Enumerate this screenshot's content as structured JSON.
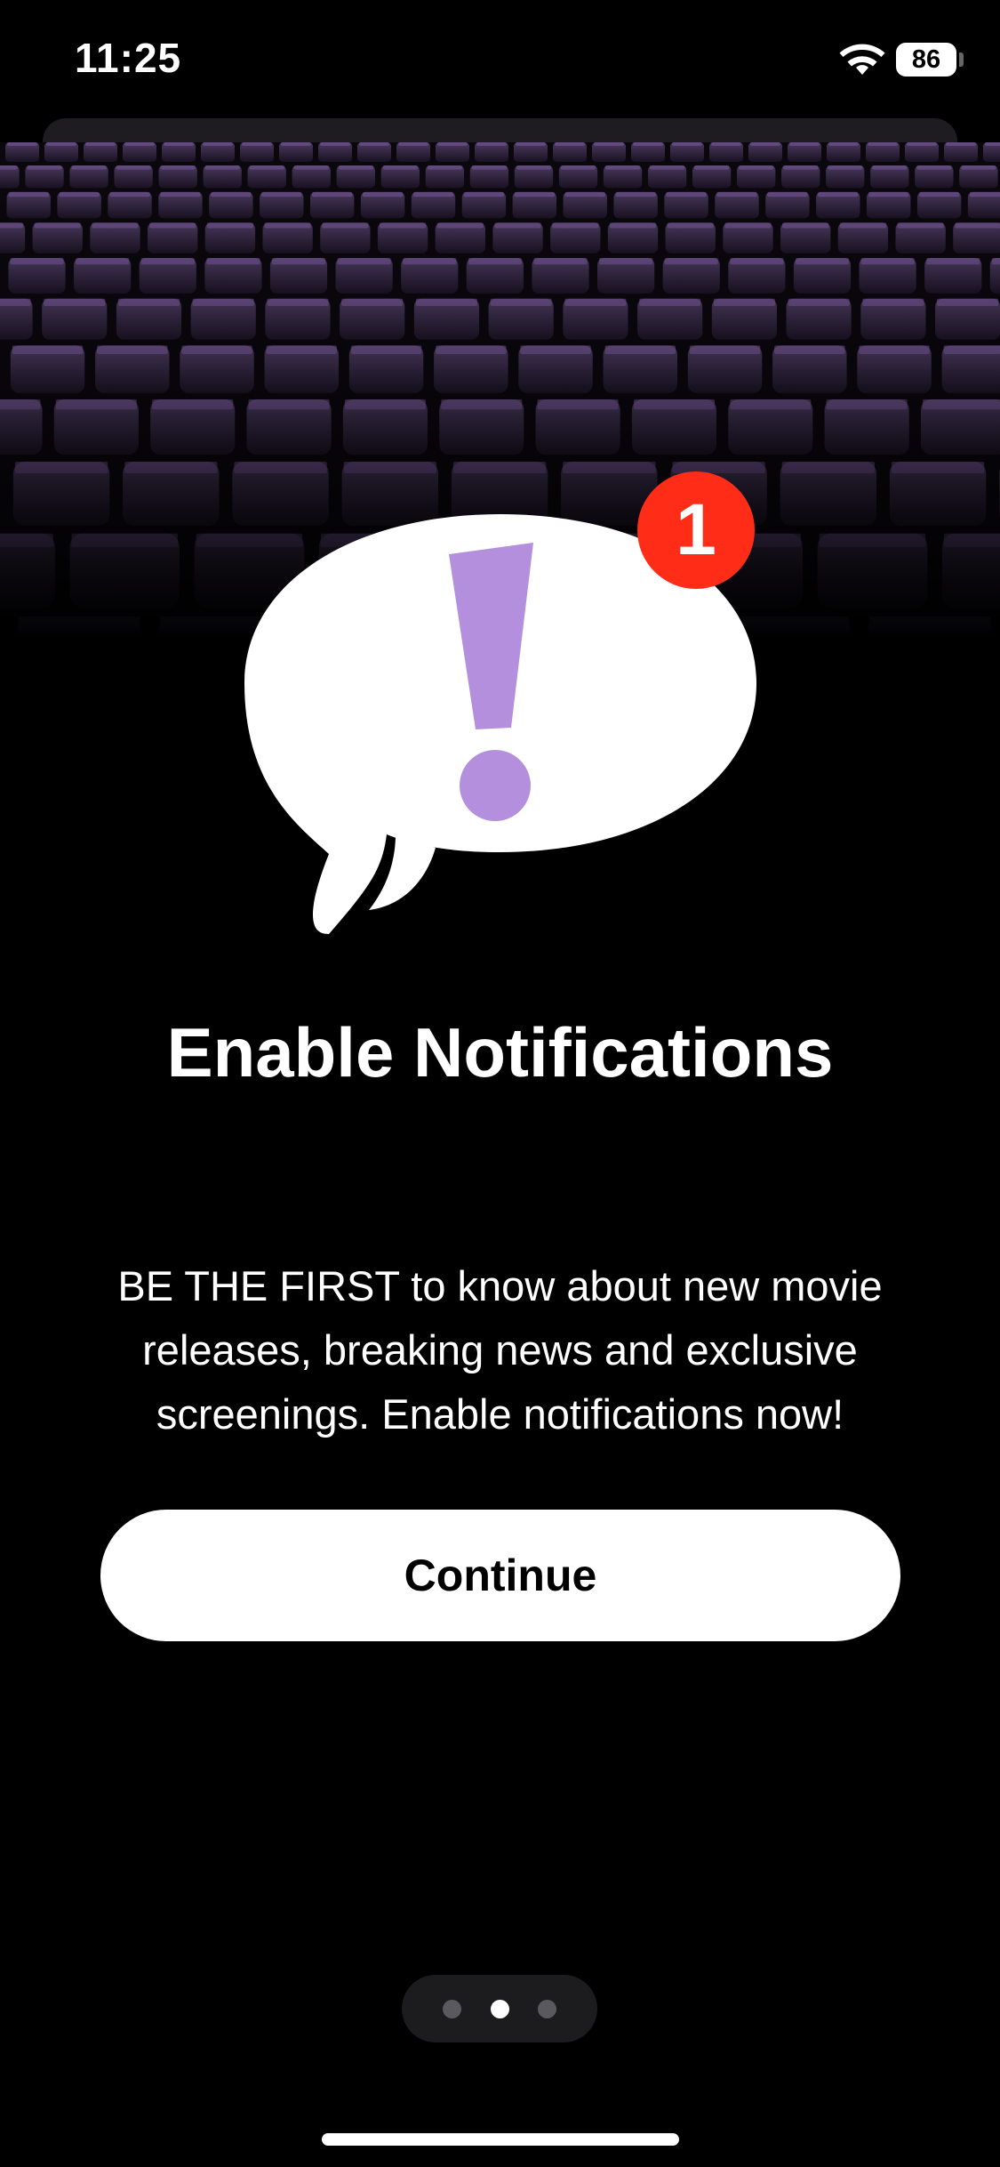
{
  "status_bar": {
    "time": "11:25",
    "battery": "86",
    "wifi_icon": "wifi-icon"
  },
  "hero": {
    "image": "cinema-seats-image",
    "illustration_icon": "speech-bubble-exclamation-icon",
    "badge_count": "1"
  },
  "onboarding": {
    "title": "Enable Notifications",
    "description": "BE THE FIRST to know about new movie releases, breaking news and exclusive screenings. Enable notifications now!",
    "continue_label": "Continue"
  },
  "pager": {
    "total": 3,
    "active_index": 1
  },
  "colors": {
    "background": "#000000",
    "accent_purple": "#b48fdd",
    "badge_red": "#ff2d17"
  }
}
